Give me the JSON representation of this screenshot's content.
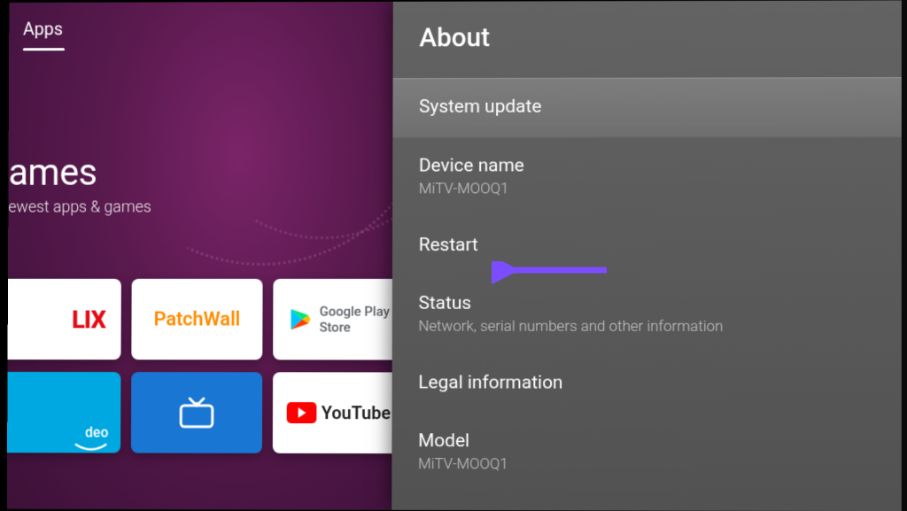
{
  "home": {
    "tab": "Apps",
    "promo_title": "ames",
    "promo_subtitle": "ewest apps & games",
    "tiles": {
      "netflix": "LIX",
      "patchwall": "PatchWall",
      "play_label_line1": "Google Play",
      "play_label_line2": "Store",
      "prime": "deo",
      "youtube": "YouTube"
    }
  },
  "settings": {
    "header": "About",
    "items": [
      {
        "title": "System update",
        "sub": ""
      },
      {
        "title": "Device name",
        "sub": "MiTV-MOOQ1"
      },
      {
        "title": "Restart",
        "sub": ""
      },
      {
        "title": "Status",
        "sub": "Network, serial numbers and other information"
      },
      {
        "title": "Legal information",
        "sub": ""
      },
      {
        "title": "Model",
        "sub": "MiTV-MOOQ1"
      }
    ]
  },
  "annotation": {
    "color": "#7c4dff"
  }
}
